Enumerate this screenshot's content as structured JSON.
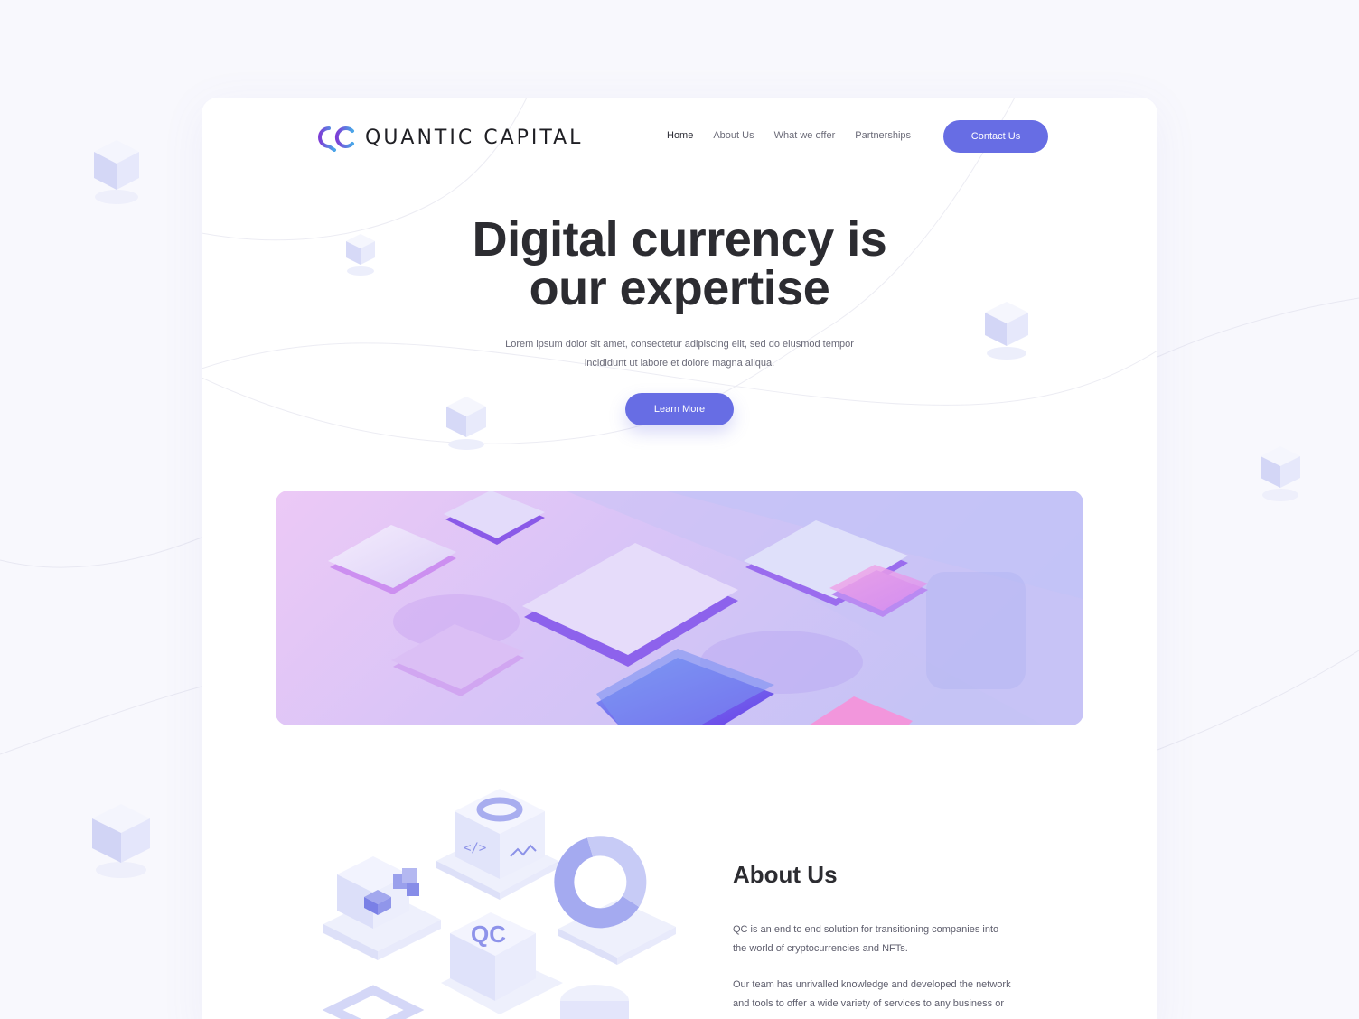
{
  "brand": {
    "name": "QUANTIC CAPITAL",
    "accent": "#676de4",
    "logo_gradient": [
      "#7d3fd6",
      "#4aa6e8"
    ]
  },
  "nav": {
    "items": [
      {
        "label": "Home",
        "active": true
      },
      {
        "label": "About Us",
        "active": false
      },
      {
        "label": "What we offer",
        "active": false
      },
      {
        "label": "Partnerships",
        "active": false
      }
    ],
    "cta_label": "Contact Us"
  },
  "hero": {
    "title_line1": "Digital currency is",
    "title_line2": "our expertise",
    "subtitle_line1": "Lorem ipsum dolor sit amet, consectetur adipiscing elit, sed do eiusmod tempor",
    "subtitle_line2": "incididunt ut labore et dolore magna aliqua.",
    "button_label": "Learn More"
  },
  "about": {
    "title": "About Us",
    "paragraph1_line1": "QC is an end to end solution for transitioning companies into",
    "paragraph1_line2": "the world of cryptocurrencies and NFTs.",
    "paragraph2_line1": "Our team has unrivalled knowledge and developed the network",
    "paragraph2_line2": "and tools to offer a wide variety of services to any business or"
  },
  "colors": {
    "background": "#f8f8fd",
    "card": "#ffffff",
    "cube_light": "#eef0fc",
    "cube_mid": "#c9ccf3",
    "banner_pink": "#e7c7f5",
    "banner_violet": "#a89bf2"
  }
}
